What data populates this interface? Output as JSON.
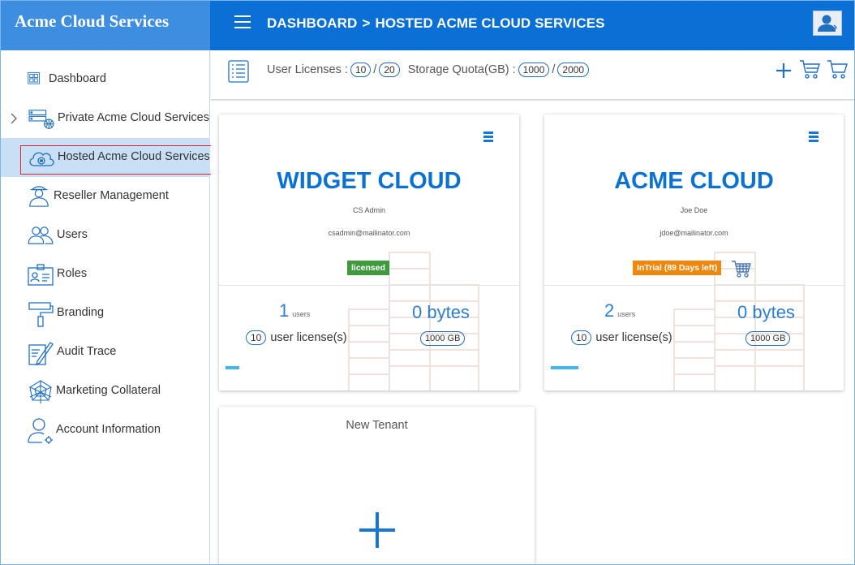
{
  "app": {
    "brand": "Acme Cloud Services"
  },
  "header": {
    "breadcrumb": [
      "DASHBOARD",
      "HOSTED ACME CLOUD SERVICES"
    ],
    "separator": ">"
  },
  "sidebar": {
    "items": [
      {
        "label": "Dashboard",
        "icon": "dashboard-icon"
      },
      {
        "label": "Private Acme Cloud Services",
        "icon": "server-globe-icon"
      },
      {
        "label": "Hosted Acme Cloud Services",
        "icon": "cloud-icon",
        "active": true
      },
      {
        "label": "Reseller Management",
        "icon": "reseller-person-icon"
      },
      {
        "label": "Users",
        "icon": "users-icon"
      },
      {
        "label": "Roles",
        "icon": "id-card-icon"
      },
      {
        "label": "Branding",
        "icon": "paint-roller-icon"
      },
      {
        "label": "Audit Trace",
        "icon": "audit-pen-icon"
      },
      {
        "label": "Marketing Collateral",
        "icon": "network-web-icon"
      },
      {
        "label": "Account Information",
        "icon": "user-gear-icon"
      }
    ]
  },
  "toolbar": {
    "user_licenses_label": "User Licenses :",
    "user_licenses_used": "10",
    "user_licenses_total": "20",
    "storage_label": "Storage Quota(GB) :",
    "storage_used": "1000",
    "storage_total": "2000",
    "slash": "/"
  },
  "tenants": [
    {
      "name": "WIDGET CLOUD",
      "owner": "CS Admin",
      "email": "csadmin@mailinator.com",
      "status": "licensed",
      "status_color": "#3e9a3c",
      "user_count": "1",
      "users_label": "users",
      "storage_used": "0 bytes",
      "licenses": "10",
      "licenses_label": "user license(s)",
      "quota": "1000 GB",
      "progress": 0.05
    },
    {
      "name": "ACME CLOUD",
      "owner": "Joe Doe",
      "email": "jdoe@mailinator.com",
      "status": "InTrial (89 Days left)",
      "status_color": "#f0870a",
      "user_count": "2",
      "users_label": "users",
      "storage_used": "0 bytes",
      "licenses": "10",
      "licenses_label": "user license(s)",
      "quota": "1000 GB",
      "progress": 0.1
    }
  ],
  "new_tenant": {
    "label": "New Tenant"
  },
  "colors": {
    "brand": "#3d8de0",
    "topbar": "#0a70d6",
    "accent": "#0b72d2",
    "active_nav": "#c9dff5"
  }
}
